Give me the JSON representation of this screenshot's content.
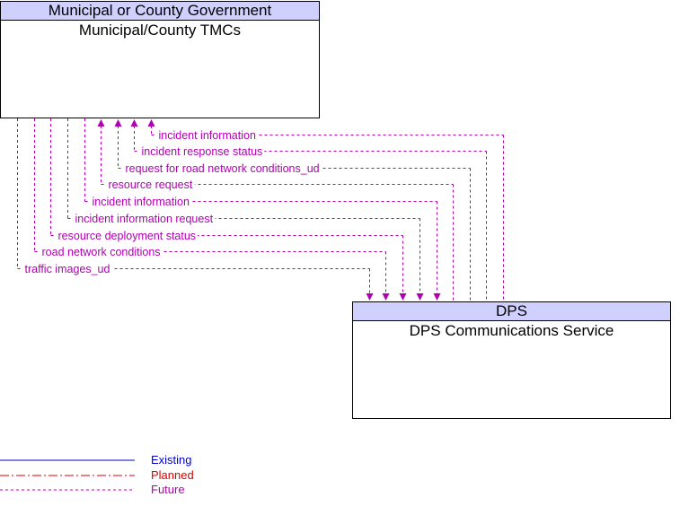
{
  "elements": [
    {
      "id": "tmc",
      "group": "Municipal or County Government",
      "name": "Municipal/County TMCs"
    },
    {
      "id": "dps",
      "group": "DPS",
      "name": "DPS Communications Service"
    }
  ],
  "flows": [
    {
      "label": "incident information",
      "direction": "to-tmc",
      "status": "Future"
    },
    {
      "label": "incident response status",
      "direction": "to-tmc",
      "status": "Future"
    },
    {
      "label": "request for road network conditions_ud",
      "direction": "to-tmc",
      "status": "Future"
    },
    {
      "label": "resource request",
      "direction": "to-tmc",
      "status": "Future"
    },
    {
      "label": "incident information",
      "direction": "to-dps",
      "status": "Future"
    },
    {
      "label": "incident information request",
      "direction": "to-dps",
      "status": "Future"
    },
    {
      "label": "resource deployment status",
      "direction": "to-dps",
      "status": "Future"
    },
    {
      "label": "road network conditions",
      "direction": "to-dps",
      "status": "Future"
    },
    {
      "label": "traffic images_ud",
      "direction": "to-dps",
      "status": "Future"
    }
  ],
  "legend": [
    {
      "label": "Existing",
      "color": "#0000cc",
      "style": "solid"
    },
    {
      "label": "Planned",
      "color": "#dd0000",
      "style": "dash-dot"
    },
    {
      "label": "Future",
      "color": "#b000b0",
      "style": "dashed"
    }
  ],
  "colors": {
    "flow": "#b000b0",
    "header_fill": "#d0d0ff"
  }
}
